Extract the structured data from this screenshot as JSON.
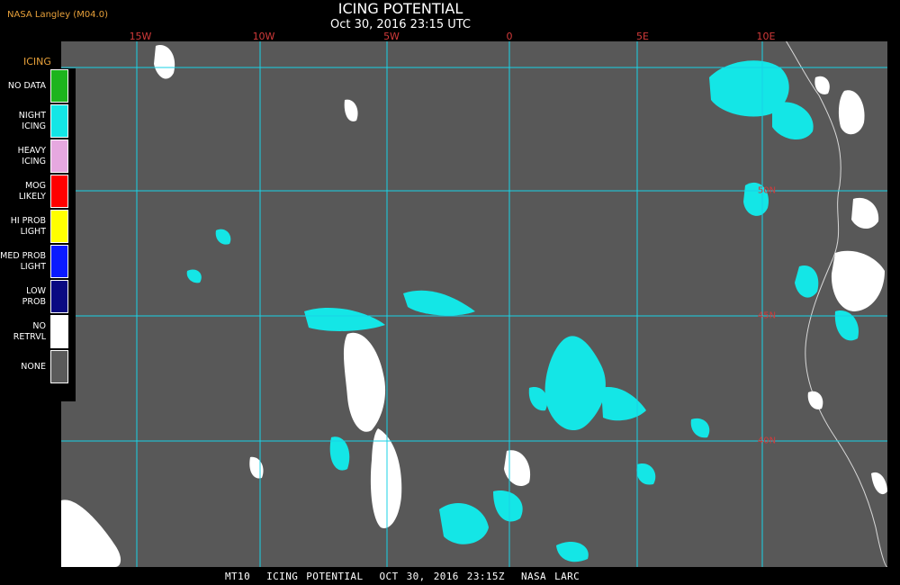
{
  "header": {
    "credit": "NASA Langley (M04.0)",
    "title": "ICING POTENTIAL",
    "subtitle": "Oct 30, 2016 23:15 UTC"
  },
  "longitude_labels": [
    "15W",
    "10W",
    "5W",
    "0",
    "5E",
    "10E"
  ],
  "latitude_labels": [
    "50N",
    "45N",
    "40N"
  ],
  "legend": {
    "title": "ICING",
    "items": [
      {
        "label": "NO DATA",
        "color": "#1db41d"
      },
      {
        "label": "NIGHT\nICING",
        "color": "#14e6e6"
      },
      {
        "label": "HEAVY\nICING",
        "color": "#e6a8e0"
      },
      {
        "label": "MOG\nLIKELY",
        "color": "#ff0000"
      },
      {
        "label": "HI PROB\nLIGHT",
        "color": "#ffff00"
      },
      {
        "label": "MED PROB\nLIGHT",
        "color": "#0a1aff"
      },
      {
        "label": "LOW\nPROB",
        "color": "#0a0a82"
      },
      {
        "label": "NO\nRETRVL",
        "color": "#ffffff"
      },
      {
        "label": "NONE",
        "color": "#5a5a5a"
      }
    ]
  },
  "colors": {
    "background": "#000000",
    "map_fill": "#585858",
    "gridline": "#19d2e6",
    "label_red": "#d23a3a",
    "credit_orange": "#e8a13a",
    "night_icing": "#14e6e6",
    "no_retrieval": "#ffffff"
  },
  "footer": "MT10  ICING POTENTIAL  OCT 30, 2016 23:15Z  NASA LARC"
}
